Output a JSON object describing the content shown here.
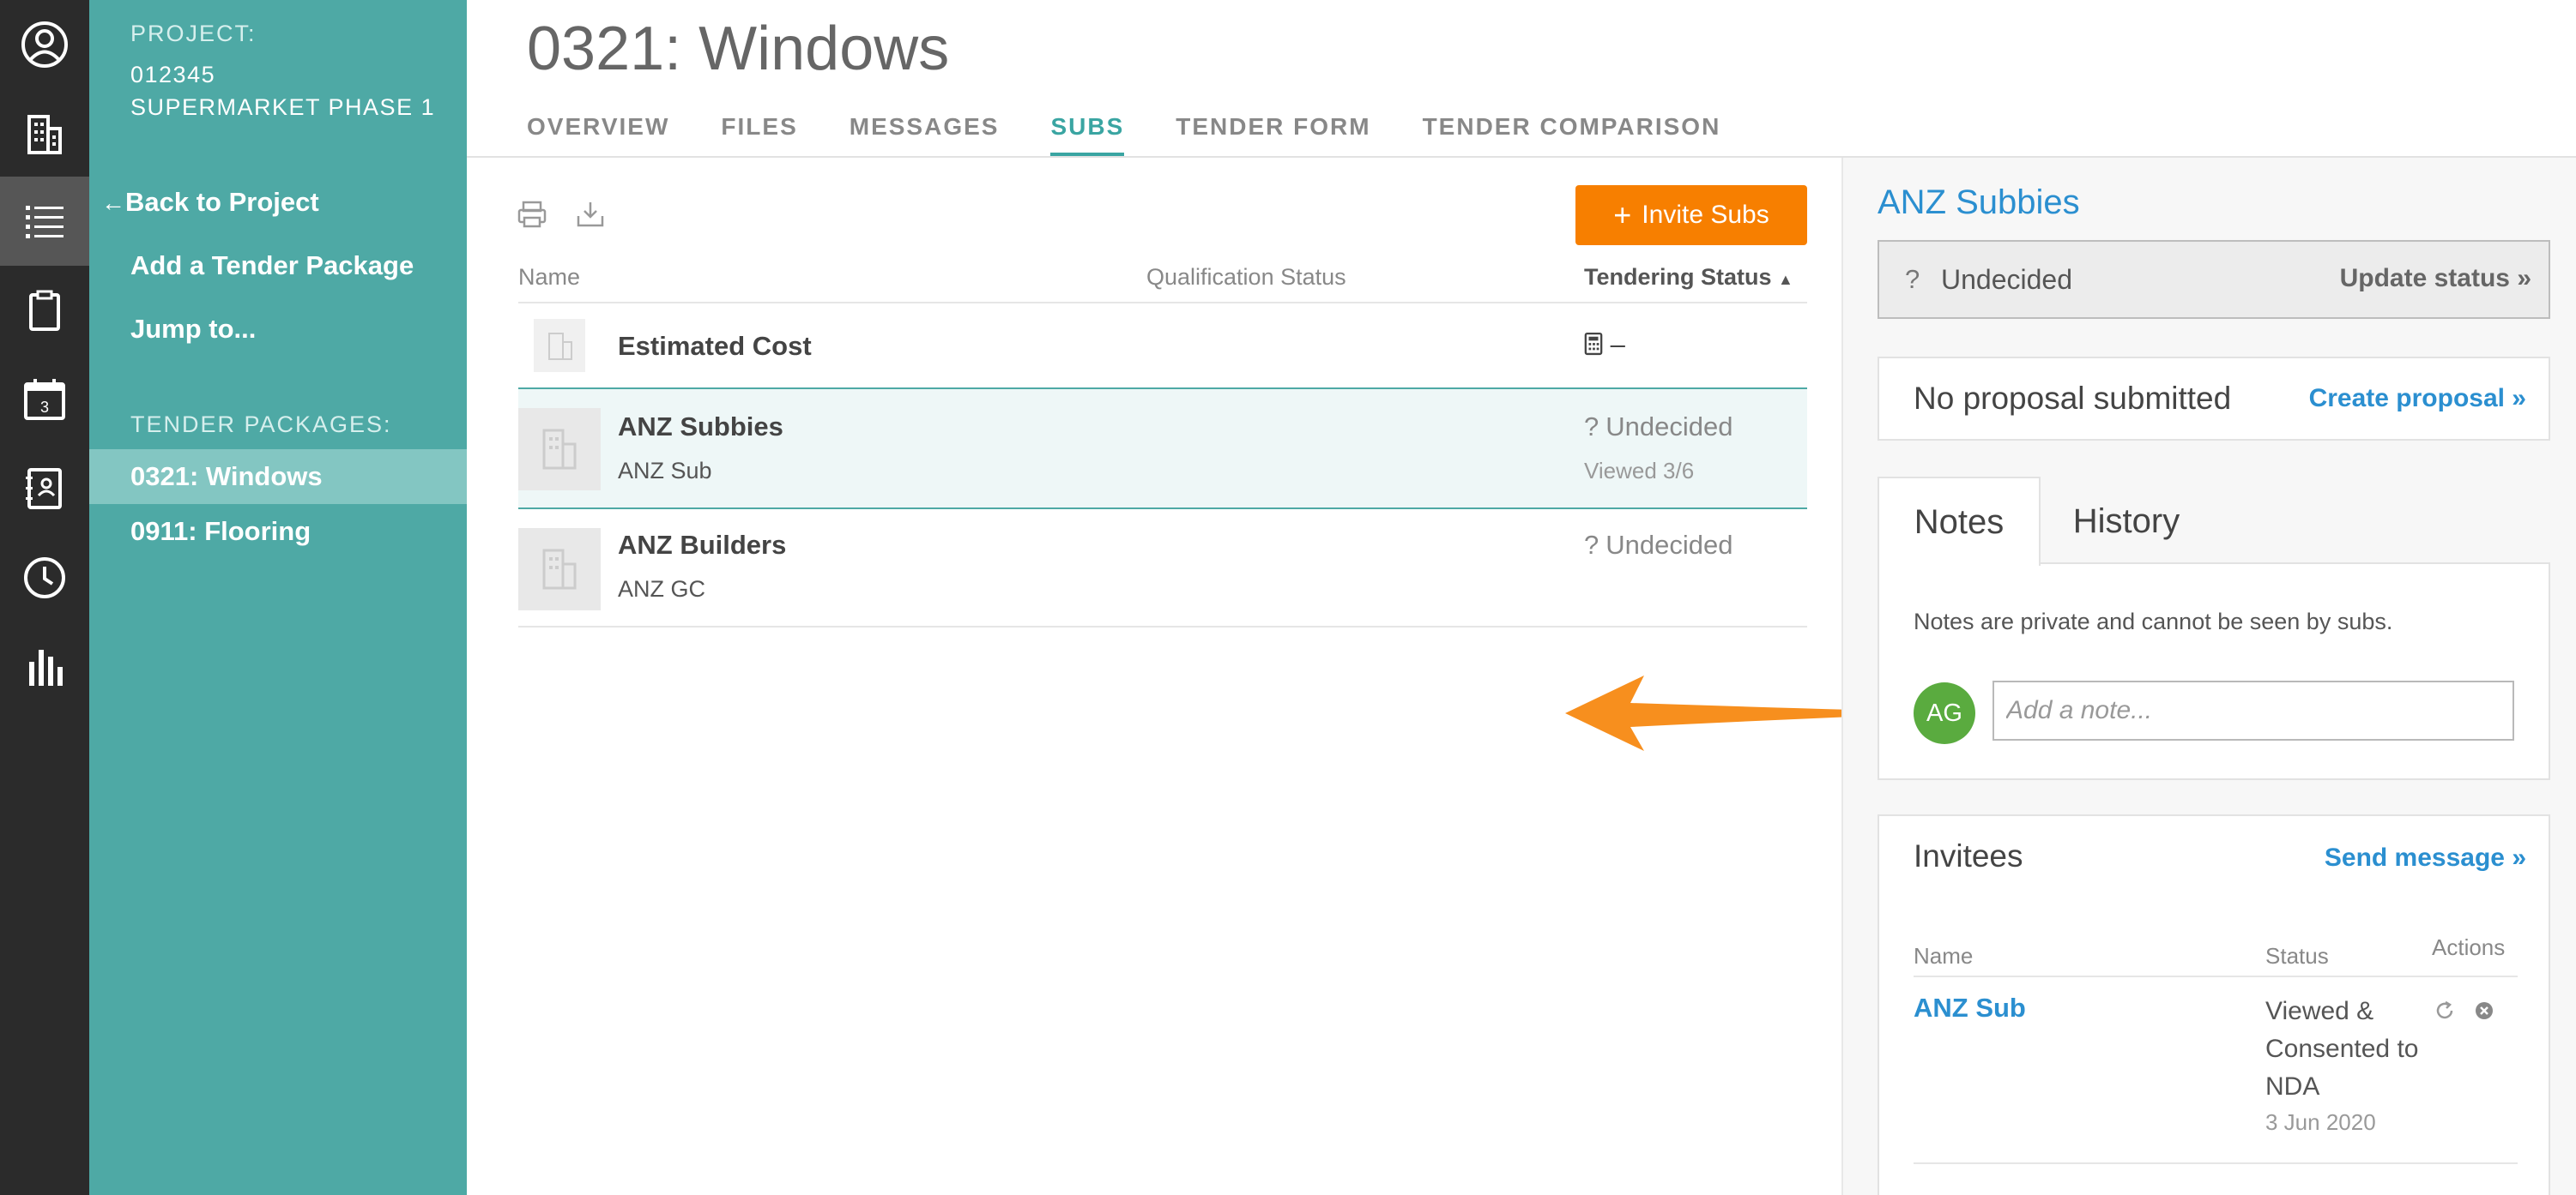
{
  "rail": {
    "items": [
      "profile-icon",
      "building-icon",
      "list-icon",
      "clipboard-icon",
      "calendar-icon",
      "address-book-icon",
      "clock-icon",
      "chart-icon"
    ],
    "calendar_day": "3"
  },
  "sidebar": {
    "project_label": "PROJECT:",
    "project_number": "012345",
    "project_name": "SUPERMARKET PHASE 1",
    "back_link": "Back to Project",
    "add_package": "Add a Tender Package",
    "jump": "Jump to...",
    "packages_label": "TENDER PACKAGES:",
    "packages": [
      {
        "label": "0321: Windows",
        "active": true
      },
      {
        "label": "0911: Flooring",
        "active": false
      }
    ]
  },
  "header": {
    "title": "0321: Windows",
    "tabs": [
      {
        "label": "OVERVIEW"
      },
      {
        "label": "FILES"
      },
      {
        "label": "MESSAGES"
      },
      {
        "label": "SUBS",
        "active": true
      },
      {
        "label": "TENDER FORM"
      },
      {
        "label": "TENDER COMPARISON"
      }
    ]
  },
  "list": {
    "invite_button": "Invite Subs",
    "columns": {
      "name": "Name",
      "qualification": "Qualification Status",
      "tendering": "Tendering Status"
    },
    "estimated": {
      "name": "Estimated Cost",
      "value": "–"
    },
    "rows": [
      {
        "name": "ANZ Subbies",
        "sub": "ANZ Sub",
        "status": "Undecided",
        "viewed": "Viewed 3/6"
      },
      {
        "name": "ANZ Builders",
        "sub": "ANZ GC",
        "status": "Undecided",
        "viewed": ""
      }
    ]
  },
  "panel": {
    "title": "ANZ Subbies",
    "status_icon": "?",
    "status": "Undecided",
    "update_link": "Update status »",
    "proposal_text": "No proposal submitted",
    "create_proposal": "Create proposal »",
    "tabs": {
      "notes": "Notes",
      "history": "History"
    },
    "notes_hint": "Notes are private and cannot be seen by subs.",
    "avatar_initials": "AG",
    "note_placeholder": "Add a note...",
    "invitees": {
      "title": "Invitees",
      "send_message": "Send message »",
      "col_name": "Name",
      "col_status": "Status",
      "col_actions": "Actions",
      "rows": [
        {
          "name": "ANZ Sub",
          "status": "Viewed & Consented to NDA",
          "date": "3 Jun 2020"
        }
      ]
    }
  },
  "colors": {
    "teal": "#4ea9a5",
    "orange": "#f77f00",
    "link_blue": "#2b8fd0",
    "rail": "#2b2b2b"
  }
}
